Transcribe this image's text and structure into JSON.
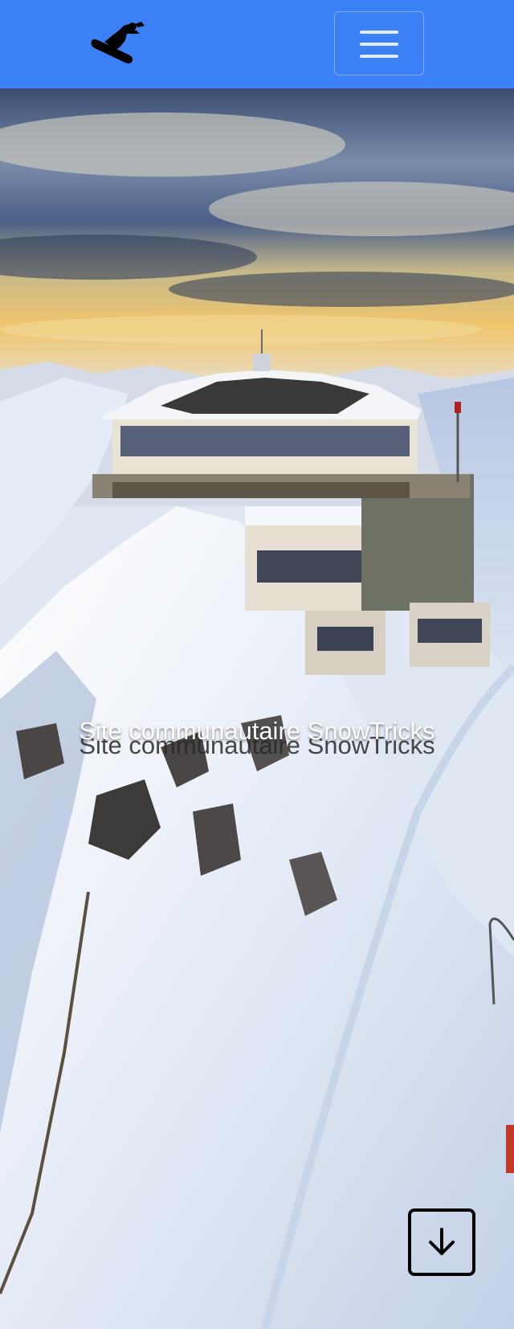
{
  "navbar": {
    "brand_icon": "snowboarder-logo-icon",
    "toggler_icon": "hamburger-menu-icon",
    "background_color": "#3b80f5"
  },
  "hero": {
    "title": "Site communautaire SnowTricks",
    "scroll_icon": "arrow-down-icon"
  }
}
